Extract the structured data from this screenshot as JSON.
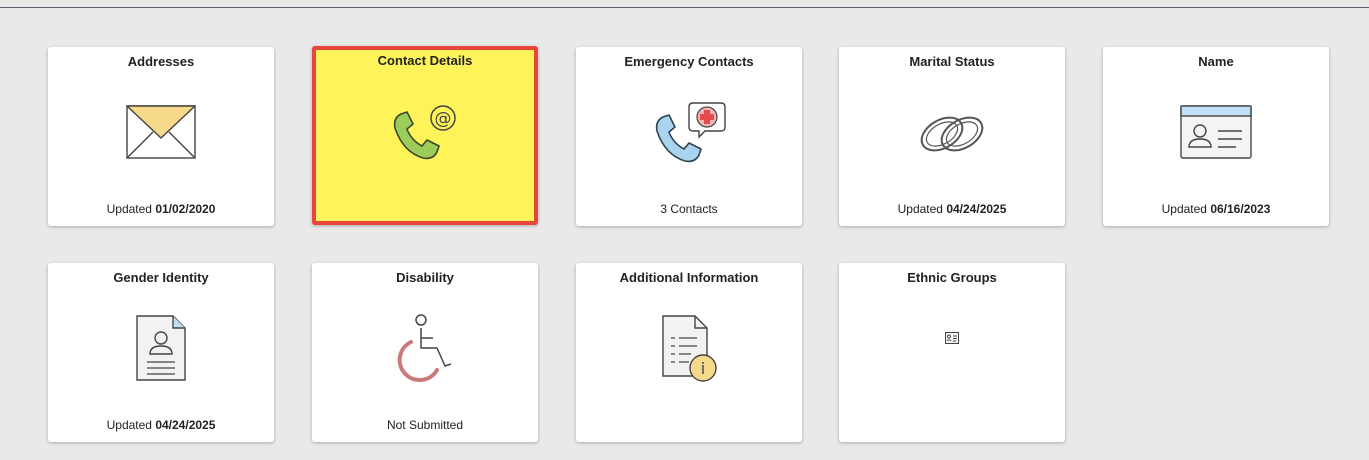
{
  "tiles": [
    {
      "title": "Addresses",
      "footer_prefix": "Updated",
      "footer_value": "01/02/2020",
      "icon": "envelope-icon"
    },
    {
      "title": "Contact Details",
      "footer_prefix": "",
      "footer_value": "",
      "icon": "phone-at-icon"
    },
    {
      "title": "Emergency Contacts",
      "footer_prefix": "3 Contacts",
      "footer_value": "",
      "icon": "phone-medical-icon"
    },
    {
      "title": "Marital Status",
      "footer_prefix": "Updated",
      "footer_value": "04/24/2025",
      "icon": "rings-icon"
    },
    {
      "title": "Name",
      "footer_prefix": "Updated",
      "footer_value": "06/16/2023",
      "icon": "id-card-icon"
    },
    {
      "title": "Gender Identity",
      "footer_prefix": "Updated",
      "footer_value": "04/24/2025",
      "icon": "person-document-icon"
    },
    {
      "title": "Disability",
      "footer_prefix": "Not Submitted",
      "footer_value": "",
      "icon": "wheelchair-icon"
    },
    {
      "title": "Additional Information",
      "footer_prefix": "",
      "footer_value": "",
      "icon": "document-info-icon"
    },
    {
      "title": "Ethnic Groups",
      "footer_prefix": "",
      "footer_value": "",
      "icon": "small-id-card-icon"
    }
  ],
  "colors": {
    "selected_bg": "#fff35a",
    "selected_border": "#e8453c",
    "page_bg": "#e8e9e8"
  }
}
